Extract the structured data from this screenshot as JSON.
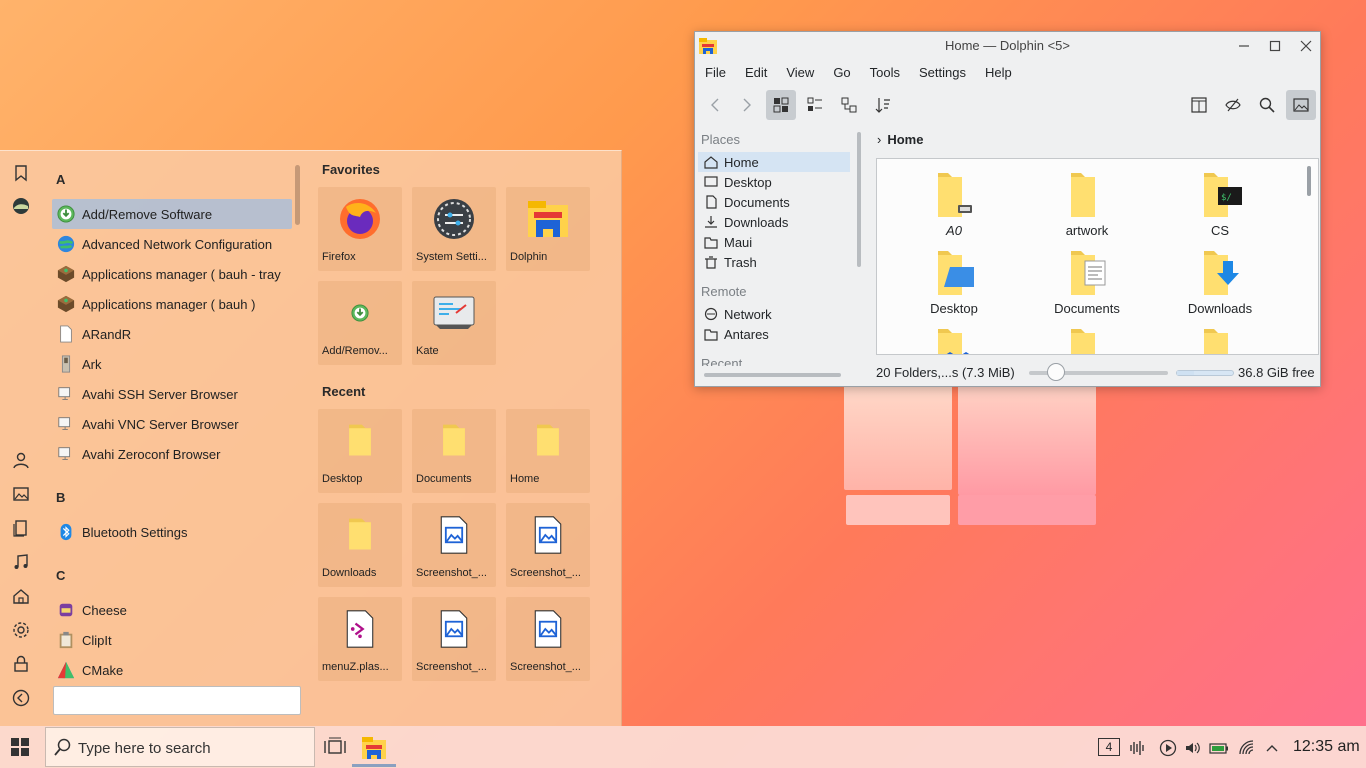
{
  "start_menu": {
    "apps": [
      {
        "type": "letter",
        "label": "A"
      },
      {
        "type": "app",
        "label": "Add/Remove Software",
        "icon": "download-green-icon",
        "selected": true
      },
      {
        "type": "app",
        "label": "Advanced Network Configuration",
        "icon": "network-globe-icon"
      },
      {
        "type": "app",
        "label": "Applications manager ( bauh - tray",
        "icon": "box-icon"
      },
      {
        "type": "app",
        "label": "Applications manager ( bauh )",
        "icon": "box-icon"
      },
      {
        "type": "app",
        "label": "ARandR",
        "icon": "document-icon"
      },
      {
        "type": "app",
        "label": "Ark",
        "icon": "archive-icon"
      },
      {
        "type": "app",
        "label": "Avahi SSH Server Browser",
        "icon": "monitor-icon"
      },
      {
        "type": "app",
        "label": "Avahi VNC Server Browser",
        "icon": "monitor-icon"
      },
      {
        "type": "app",
        "label": "Avahi Zeroconf Browser",
        "icon": "monitor-icon"
      },
      {
        "type": "letter",
        "label": "B"
      },
      {
        "type": "app",
        "label": "Bluetooth Settings",
        "icon": "bluetooth-icon"
      },
      {
        "type": "letter",
        "label": "C"
      },
      {
        "type": "app",
        "label": "Cheese",
        "icon": "cheese-icon"
      },
      {
        "type": "app",
        "label": "ClipIt",
        "icon": "clipboard-icon"
      },
      {
        "type": "app",
        "label": "CMake",
        "icon": "cmake-icon"
      }
    ],
    "favorites_title": "Favorites",
    "favorites": [
      {
        "label": "Firefox",
        "icon": "firefox-icon"
      },
      {
        "label": "System Setti...",
        "icon": "system-settings-icon"
      },
      {
        "label": "Dolphin",
        "icon": "dolphin-icon"
      },
      {
        "label": "Add/Remov...",
        "icon": "download-green-icon"
      },
      {
        "label": "Kate",
        "icon": "kate-icon"
      }
    ],
    "recent_title": "Recent",
    "recent": [
      {
        "label": "Desktop",
        "icon": "folder-icon"
      },
      {
        "label": "Documents",
        "icon": "folder-icon"
      },
      {
        "label": "Home",
        "icon": "folder-icon"
      },
      {
        "label": "Downloads",
        "icon": "folder-icon"
      },
      {
        "label": "Screenshot_...",
        "icon": "image-file-icon"
      },
      {
        "label": "Screenshot_...",
        "icon": "image-file-icon"
      },
      {
        "label": "menuZ.plas...",
        "icon": "plasmoid-file-icon"
      },
      {
        "label": "Screenshot_...",
        "icon": "image-file-icon"
      },
      {
        "label": "Screenshot_...",
        "icon": "image-file-icon"
      }
    ],
    "search_value": ""
  },
  "dolphin": {
    "title": "Home — Dolphin <5>",
    "menu": [
      "File",
      "Edit",
      "View",
      "Go",
      "Tools",
      "Settings",
      "Help"
    ],
    "places_head": "Places",
    "places": [
      {
        "label": "Home",
        "icon": "home-icon",
        "selected": true
      },
      {
        "label": "Desktop",
        "icon": "desktop-icon"
      },
      {
        "label": "Documents",
        "icon": "documents-icon"
      },
      {
        "label": "Downloads",
        "icon": "downloads-icon"
      },
      {
        "label": "Maui",
        "icon": "folder-icon"
      },
      {
        "label": "Trash",
        "icon": "trash-icon"
      }
    ],
    "remote_head": "Remote",
    "remote": [
      {
        "label": "Network",
        "icon": "network-icon"
      },
      {
        "label": "Antares",
        "icon": "folder-icon"
      }
    ],
    "recent_head": "Recent",
    "breadcrumb": "Home",
    "files": [
      {
        "label": "A0",
        "italic": true,
        "emblem": "drive"
      },
      {
        "label": "artwork",
        "emblem": ""
      },
      {
        "label": "CS",
        "emblem": "terminal"
      },
      {
        "label": "Desktop",
        "emblem": "desktop"
      },
      {
        "label": "Documents",
        "emblem": "documents"
      },
      {
        "label": "Downloads",
        "emblem": "downloads"
      },
      {
        "label": "",
        "emblem": "dropbox"
      },
      {
        "label": "",
        "emblem": ""
      },
      {
        "label": "",
        "emblem": "music"
      }
    ],
    "status_text": "20 Folders,...s (7.3 MiB)",
    "free_space": "36.8 GiB free",
    "used_fraction": 0.3
  },
  "taskbar": {
    "search_placeholder": "Type here to search",
    "desktop_number": "4",
    "clock": "12:35 am"
  }
}
